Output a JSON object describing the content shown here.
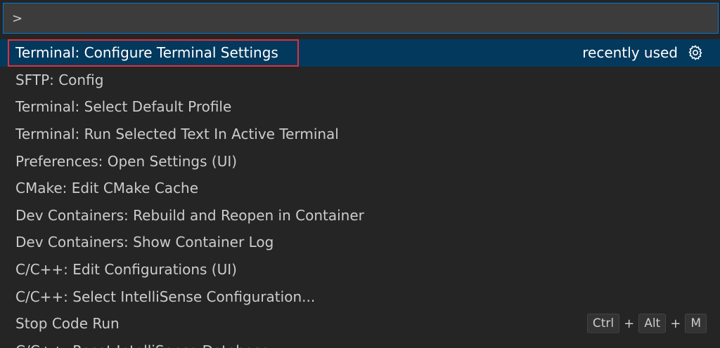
{
  "quick_open": {
    "input_value": ">",
    "items": [
      {
        "label": "Terminal: Configure Terminal Settings",
        "detail": "recently used",
        "icon": "gear-icon"
      },
      {
        "label": "SFTP: Config"
      },
      {
        "label": "Terminal: Select Default Profile"
      },
      {
        "label": "Terminal: Run Selected Text In Active Terminal"
      },
      {
        "label": "Preferences: Open Settings (UI)"
      },
      {
        "label": "CMake: Edit CMake Cache"
      },
      {
        "label": "Dev Containers: Rebuild and Reopen in Container"
      },
      {
        "label": "Dev Containers: Show Container Log"
      },
      {
        "label": "C/C++: Edit Configurations (UI)"
      },
      {
        "label": "C/C++: Select IntelliSense Configuration..."
      },
      {
        "label": "Stop Code Run",
        "keybinding": [
          "Ctrl",
          "Alt",
          "M"
        ],
        "separator": "+"
      },
      {
        "label": "C/C++: Reset IntelliSense Database"
      }
    ]
  },
  "colors": {
    "background": "#252526",
    "input_background": "#3c3c3c",
    "focus_border": "#0078d4",
    "selected_row": "#04395e",
    "annotation_box": "#e0303b",
    "text": "#cccccc"
  }
}
